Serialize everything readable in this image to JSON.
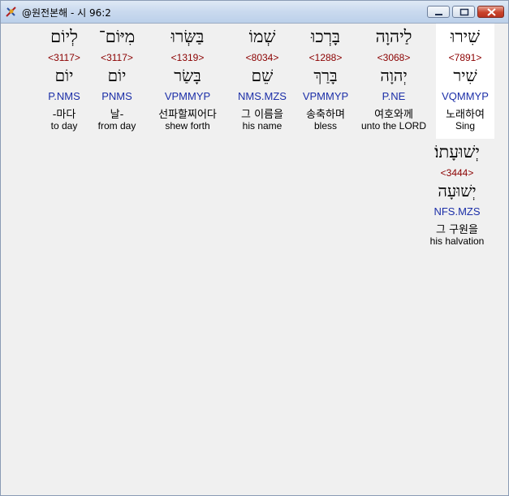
{
  "window": {
    "title": "@원전본해 - 시 96:2"
  },
  "words": [
    {
      "hebrew": "שִׁירוּ",
      "strong": "<7891>",
      "lemma": "שִׁיר",
      "morph": "VQMMYP",
      "korean": "노래하여",
      "english": "Sing"
    },
    {
      "hebrew": "לַיהוָה",
      "strong": "<3068>",
      "lemma": "יְהוָה",
      "morph": "P.NE",
      "korean": "여호와께",
      "english": "unto the LORD"
    },
    {
      "hebrew": "בָּרְכוּ",
      "strong": "<1288>",
      "lemma": "בָּרַךְ",
      "morph": "VPMMYP",
      "korean": "송축하며",
      "english": "bless"
    },
    {
      "hebrew": "שְׁמוֹ",
      "strong": "<8034>",
      "lemma": "שֵׁם",
      "morph": "NMS.MZS",
      "korean": "그 이름을",
      "english": "his name"
    },
    {
      "hebrew": "בַּשְּׂרוּ",
      "strong": "<1319>",
      "lemma": "בָּשַׂר",
      "morph": "VPMMYP",
      "korean": "선파할찌어다",
      "english": "shew forth"
    },
    {
      "hebrew": "מִיּוֹם־",
      "strong": "<3117>",
      "lemma": "יוֹם",
      "morph": "PNMS",
      "korean": "날-",
      "english": "from day"
    },
    {
      "hebrew": "לְיוֹם",
      "strong": "<3117>",
      "lemma": "יוֹם",
      "morph": "P.NMS",
      "korean": "-마다",
      "english": "to day"
    },
    {
      "hebrew": "יְשׁוּעָתוֹ׃",
      "strong": "<3444>",
      "lemma": "יְשׁוּעָה",
      "morph": "NFS.MZS",
      "korean": "그 구원을",
      "english": "his halvation"
    }
  ]
}
